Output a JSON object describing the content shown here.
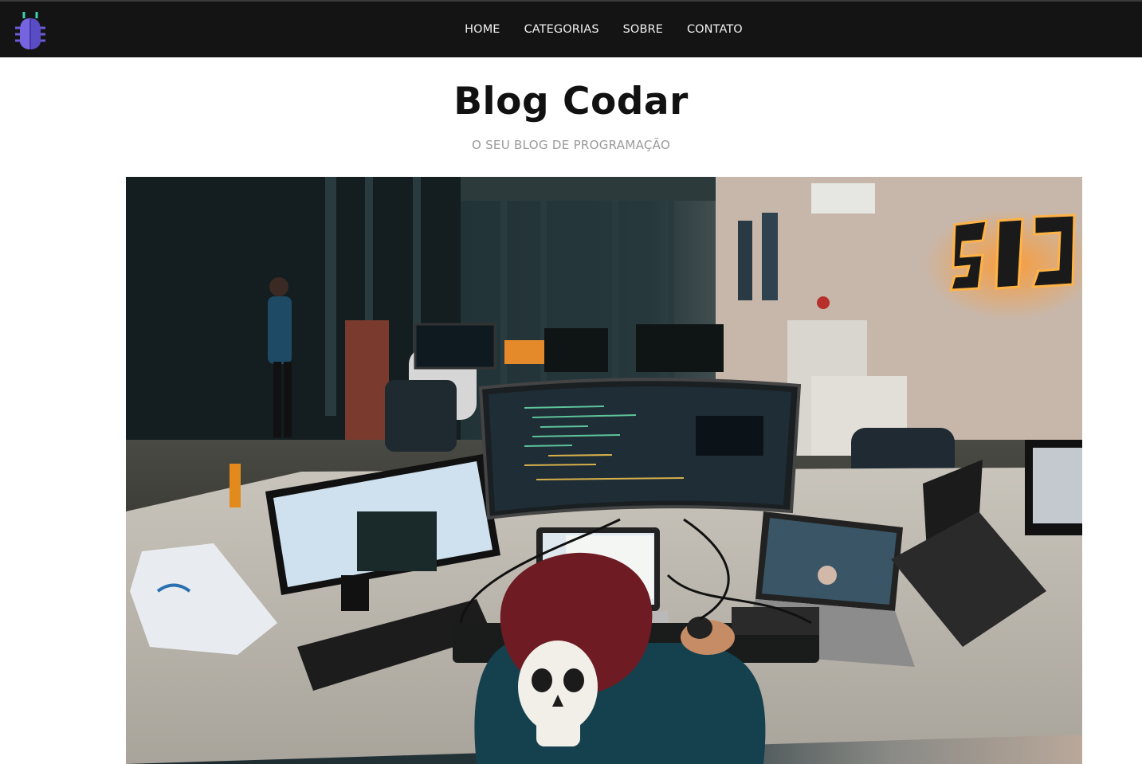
{
  "header": {
    "logo_icon": "bug-icon",
    "nav": [
      {
        "label": "HOME"
      },
      {
        "label": "CATEGORIAS"
      },
      {
        "label": "SOBRE"
      },
      {
        "label": "CONTATO"
      }
    ]
  },
  "main": {
    "title": "Blog Codar",
    "subtitle": "O SEU BLOG DE PROGRAMAÇÃO"
  },
  "colors": {
    "topbar": "#141414",
    "logo": "#6b5bd6",
    "logo_accent": "#3fd0b0",
    "title": "#111111",
    "subtitle": "#9a9a9a"
  }
}
